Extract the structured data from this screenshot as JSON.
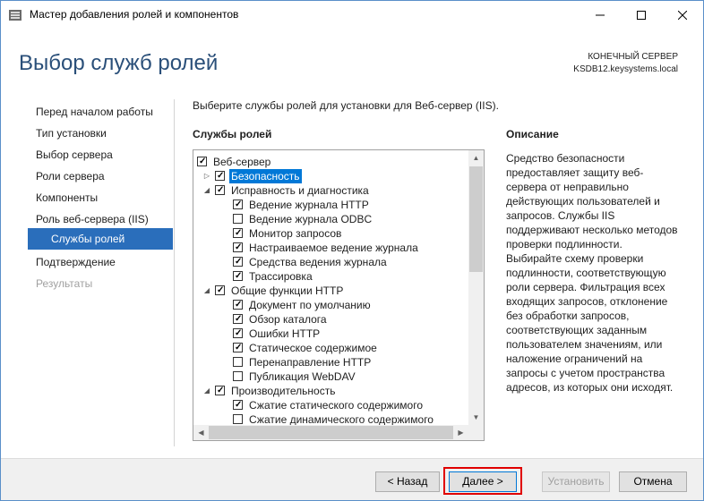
{
  "window": {
    "title": "Мастер добавления ролей и компонентов",
    "controls": {
      "minimize": "—",
      "maximize": "☐",
      "close": "✕"
    }
  },
  "header": {
    "page_title": "Выбор служб ролей",
    "server_caption": "КОНЕЧНЫЙ СЕРВЕР",
    "server_name": "KSDB12.keysystems.local"
  },
  "nav": {
    "items": [
      {
        "label": "Перед началом работы",
        "state": "normal"
      },
      {
        "label": "Тип установки",
        "state": "normal"
      },
      {
        "label": "Выбор сервера",
        "state": "normal"
      },
      {
        "label": "Роли сервера",
        "state": "normal"
      },
      {
        "label": "Компоненты",
        "state": "normal"
      },
      {
        "label": "Роль веб-сервера (IIS)",
        "state": "normal"
      },
      {
        "label": "Службы ролей",
        "state": "active"
      },
      {
        "label": "Подтверждение",
        "state": "normal"
      },
      {
        "label": "Результаты",
        "state": "disabled"
      }
    ]
  },
  "main": {
    "instruction": "Выберите службы ролей для установки для Веб-сервер (IIS).",
    "role_services_heading": "Службы ролей",
    "description_heading": "Описание",
    "tree": [
      {
        "label": "Веб-сервер",
        "level": 0,
        "checked": true,
        "expander": "none"
      },
      {
        "label": "Безопасность",
        "level": 1,
        "checked": true,
        "expander": "collapsed",
        "selected": true
      },
      {
        "label": "Исправность и диагностика",
        "level": 1,
        "checked": true,
        "expander": "expanded"
      },
      {
        "label": "Ведение журнала HTTP",
        "level": 2,
        "checked": true,
        "expander": "none"
      },
      {
        "label": "Ведение журнала ODBC",
        "level": 2,
        "checked": false,
        "expander": "none"
      },
      {
        "label": "Монитор запросов",
        "level": 2,
        "checked": true,
        "expander": "none"
      },
      {
        "label": "Настраиваемое ведение журнала",
        "level": 2,
        "checked": true,
        "expander": "none"
      },
      {
        "label": "Средства ведения журнала",
        "level": 2,
        "checked": true,
        "expander": "none"
      },
      {
        "label": "Трассировка",
        "level": 2,
        "checked": true,
        "expander": "none"
      },
      {
        "label": "Общие функции HTTP",
        "level": 1,
        "checked": true,
        "expander": "expanded"
      },
      {
        "label": "Документ по умолчанию",
        "level": 2,
        "checked": true,
        "expander": "none"
      },
      {
        "label": "Обзор каталога",
        "level": 2,
        "checked": true,
        "expander": "none"
      },
      {
        "label": "Ошибки HTTP",
        "level": 2,
        "checked": true,
        "expander": "none"
      },
      {
        "label": "Статическое содержимое",
        "level": 2,
        "checked": true,
        "expander": "none"
      },
      {
        "label": "Перенаправление HTTP",
        "level": 2,
        "checked": false,
        "expander": "none"
      },
      {
        "label": "Публикация WebDAV",
        "level": 2,
        "checked": false,
        "expander": "none"
      },
      {
        "label": "Производительность",
        "level": 1,
        "checked": true,
        "expander": "expanded"
      },
      {
        "label": "Сжатие статического содержимого",
        "level": 2,
        "checked": true,
        "expander": "none"
      },
      {
        "label": "Сжатие динамического содержимого",
        "level": 2,
        "checked": false,
        "expander": "none"
      }
    ],
    "description_lines": [
      "Средство безопасности",
      "предоставляет защиту веб-",
      "сервера от неправильно",
      "действующих пользователей и",
      "запросов. Службы IIS",
      "поддерживают несколько методов",
      "проверки подлинности.",
      "Выбирайте схему проверки",
      "подлинности, соответствующую",
      "роли сервера. Фильтрация всех",
      "входящих запросов, отклонение",
      "без обработки запросов,",
      "соответствующих заданным",
      "пользователем значениям, или",
      "наложение ограничений на",
      "запросы с учетом пространства",
      "адресов, из которых они исходят."
    ]
  },
  "footer": {
    "back_label": "< Назад",
    "next_label": "Далее >",
    "install_label": "Установить",
    "cancel_label": "Отмена"
  },
  "colors": {
    "accent": "#2a6ebb",
    "title": "#2a4f79",
    "selection": "#0078d7",
    "highlight_box": "#e00000"
  }
}
